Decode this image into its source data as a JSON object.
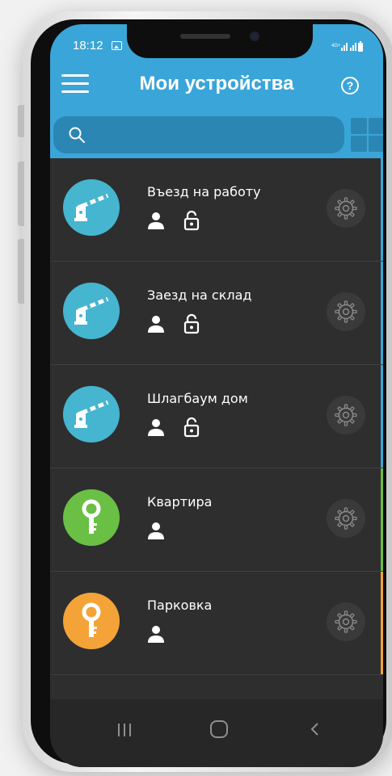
{
  "status_bar": {
    "time": "18:12"
  },
  "header": {
    "title": "Мои устройства"
  },
  "search": {
    "placeholder": "",
    "value": ""
  },
  "devices": [
    {
      "name": "Въезд на работу",
      "icon": "barrier-icon",
      "color": "#46b5cf",
      "edge_color": "#3aa5d8",
      "has_lock": true
    },
    {
      "name": "Заезд на склад",
      "icon": "barrier-icon",
      "color": "#46b5cf",
      "edge_color": "#3aa5d8",
      "has_lock": true
    },
    {
      "name": "Шлагбаум дом",
      "icon": "barrier-icon",
      "color": "#46b5cf",
      "edge_color": "#3aa5d8",
      "has_lock": true
    },
    {
      "name": "Квартира",
      "icon": "key-icon",
      "color": "#6abf45",
      "edge_color": "#6abf45",
      "has_lock": false
    },
    {
      "name": "Парковка",
      "icon": "key-icon",
      "color": "#f4a338",
      "edge_color": "#f4a338",
      "has_lock": false
    }
  ],
  "colors": {
    "header_blue": "#3aa5d8",
    "search_blue": "#2c86b4",
    "list_background": "#2e2e2e"
  }
}
